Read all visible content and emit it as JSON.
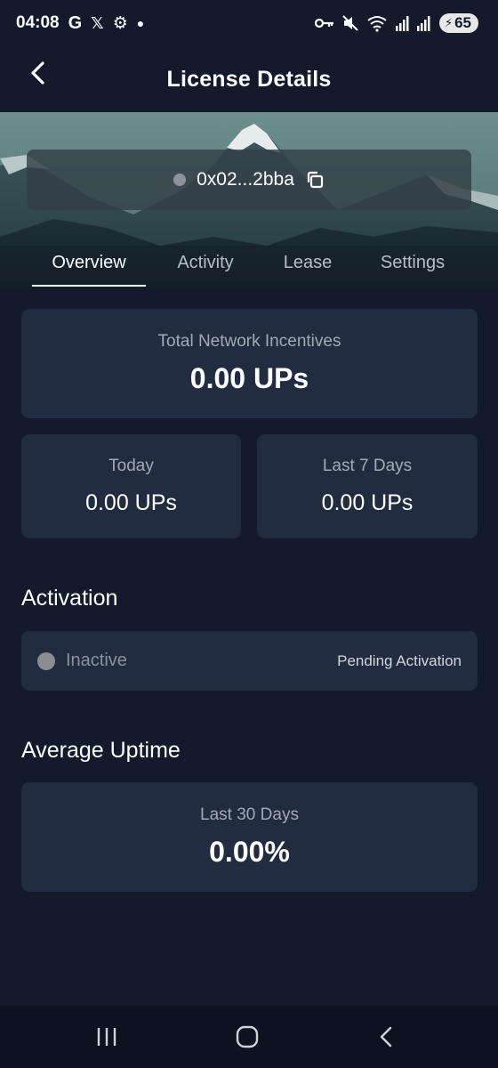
{
  "status_bar": {
    "time": "04:08",
    "battery": "65",
    "left_icons": [
      "google-icon",
      "x-icon",
      "gear-icon",
      "dot-icon"
    ],
    "right_icons": [
      "key-icon",
      "mute-icon",
      "wifi-icon",
      "signal-icon",
      "signal-r-icon",
      "battery-icon"
    ]
  },
  "header": {
    "title": "License Details"
  },
  "hero": {
    "address": "0x02...2bba"
  },
  "tabs": [
    {
      "label": "Overview",
      "active": true
    },
    {
      "label": "Activity",
      "active": false
    },
    {
      "label": "Lease",
      "active": false
    },
    {
      "label": "Settings",
      "active": false
    }
  ],
  "incentives": {
    "total_label": "Total Network Incentives",
    "total_value": "0.00 UPs",
    "today_label": "Today",
    "today_value": "0.00 UPs",
    "week_label": "Last 7 Days",
    "week_value": "0.00 UPs"
  },
  "activation": {
    "section_title": "Activation",
    "status": "Inactive",
    "pending": "Pending Activation"
  },
  "uptime": {
    "section_title": "Average Uptime",
    "label": "Last 30 Days",
    "value": "0.00%"
  },
  "colors": {
    "background": "#121a2c",
    "card": "#212c40",
    "inactive_dot": "#8b8d91"
  }
}
